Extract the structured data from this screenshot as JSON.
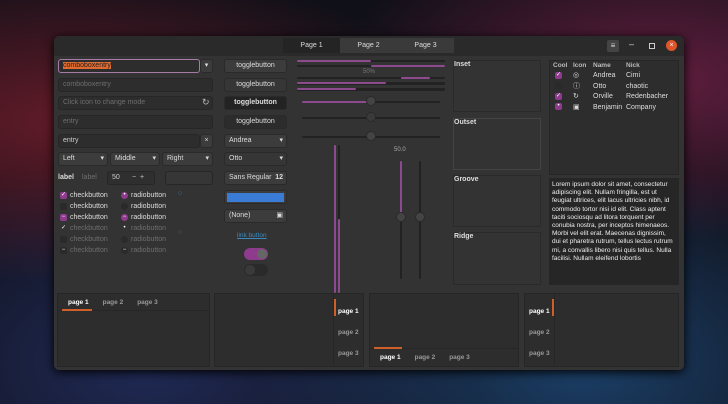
{
  "tabs": [
    "Page 1",
    "Page 2",
    "Page 3"
  ],
  "left": {
    "combo1": "comboboxentry",
    "combo2": "comboboxentry",
    "mode_placeholder": "Click icon to change mode",
    "entry_placeholder": "entry",
    "entry_value": "entry",
    "dropdowns": [
      "Left",
      "Middle",
      "Right"
    ],
    "label1": "label",
    "label2": "label",
    "spin_value": "50",
    "check_label": "checkbutton",
    "radio_label": "radiobutton"
  },
  "mid": {
    "toggles": [
      "togglebutton",
      "togglebutton",
      "togglebutton",
      "togglebutton"
    ],
    "combo_andrea": "Andrea",
    "combo_otto": "Otto",
    "font": "Sans Regular",
    "font_size": "12",
    "color": "#3a7bd5",
    "file": "(None)",
    "link": "link button"
  },
  "progress": {
    "label": "50%",
    "scale_value": "50.0",
    "values": [
      0.5,
      0.5
    ]
  },
  "frames": [
    "Inset",
    "Outset",
    "Groove",
    "Ridge"
  ],
  "tree": {
    "headers": [
      "Cool",
      "Icon",
      "Name",
      "Nick"
    ],
    "rows": [
      {
        "name": "Andrea",
        "nick": "Cimi",
        "cool": true
      },
      {
        "name": "Otto",
        "nick": "chaotic",
        "cool": false
      },
      {
        "name": "Orville",
        "nick": "Redenbacher",
        "cool": true
      },
      {
        "name": "Benjamin",
        "nick": "Company",
        "cool": "mixed"
      }
    ]
  },
  "text": "Lorem ipsum dolor sit amet, consectetur adipiscing elit. Nullam fringilla, est ut feugiat ultrices, elit lacus ultricies nibh, id commodo tortor nisi id elit. Class aptent taciti sociosqu ad litora torquent per conubia nostra, per inceptos himenaeos. Morbi vel elit erat. Maecenas dignissim, dui et pharetra rutrum, tellus lectus rutrum mi, a convallis libero nisi quis tellus. Nulla facilisi. Nullam eleifend lobortis",
  "notebook_tabs": [
    "page 1",
    "page 2",
    "page 3"
  ],
  "accent": "#8e3b8e",
  "indicator": "#d0602a"
}
